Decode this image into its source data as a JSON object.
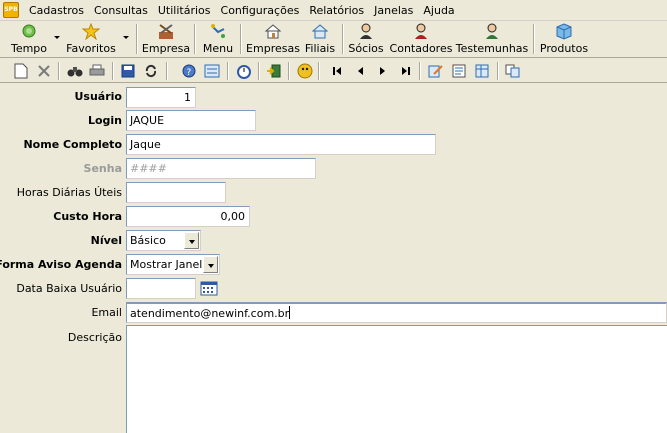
{
  "menu": {
    "logo_text": "SPB",
    "items": [
      "Cadastros",
      "Consultas",
      "Utilitários",
      "Configurações",
      "Relatórios",
      "Janelas",
      "Ajuda"
    ]
  },
  "toolbar": {
    "tempo": "Tempo",
    "favoritos": "Favoritos",
    "empresa": "Empresa",
    "menu": "Menu",
    "empresas": "Empresas",
    "filiais": "Filiais",
    "socios": "Sócios",
    "contadores": "Contadores",
    "testemunhas": "Testemunhas",
    "produtos": "Produtos"
  },
  "form": {
    "usuario": {
      "label": "Usuário",
      "value": "1"
    },
    "login": {
      "label": "Login",
      "value": "JAQUE"
    },
    "nome_completo": {
      "label": "Nome Completo",
      "value": "Jaque"
    },
    "senha": {
      "label": "Senha",
      "value": "####"
    },
    "horas": {
      "label": "Horas Diárias Úteis",
      "value": ""
    },
    "custo_hora": {
      "label": "Custo Hora",
      "value": "0,00"
    },
    "nivel": {
      "label": "Nível",
      "value": "Básico"
    },
    "forma_aviso": {
      "label": "Forma Aviso Agenda",
      "value": "Mostrar Janela"
    },
    "data_baixa": {
      "label": "Data Baixa Usuário",
      "value": ""
    },
    "email": {
      "label": "Email",
      "value": "atendimento@newinf.com.br"
    },
    "descricao": {
      "label": "Descrição",
      "value": ""
    }
  },
  "colors": {
    "window_bg": "#ece9d8",
    "input_border": "#7f9db9",
    "disabled_text": "#9a9a9a"
  }
}
